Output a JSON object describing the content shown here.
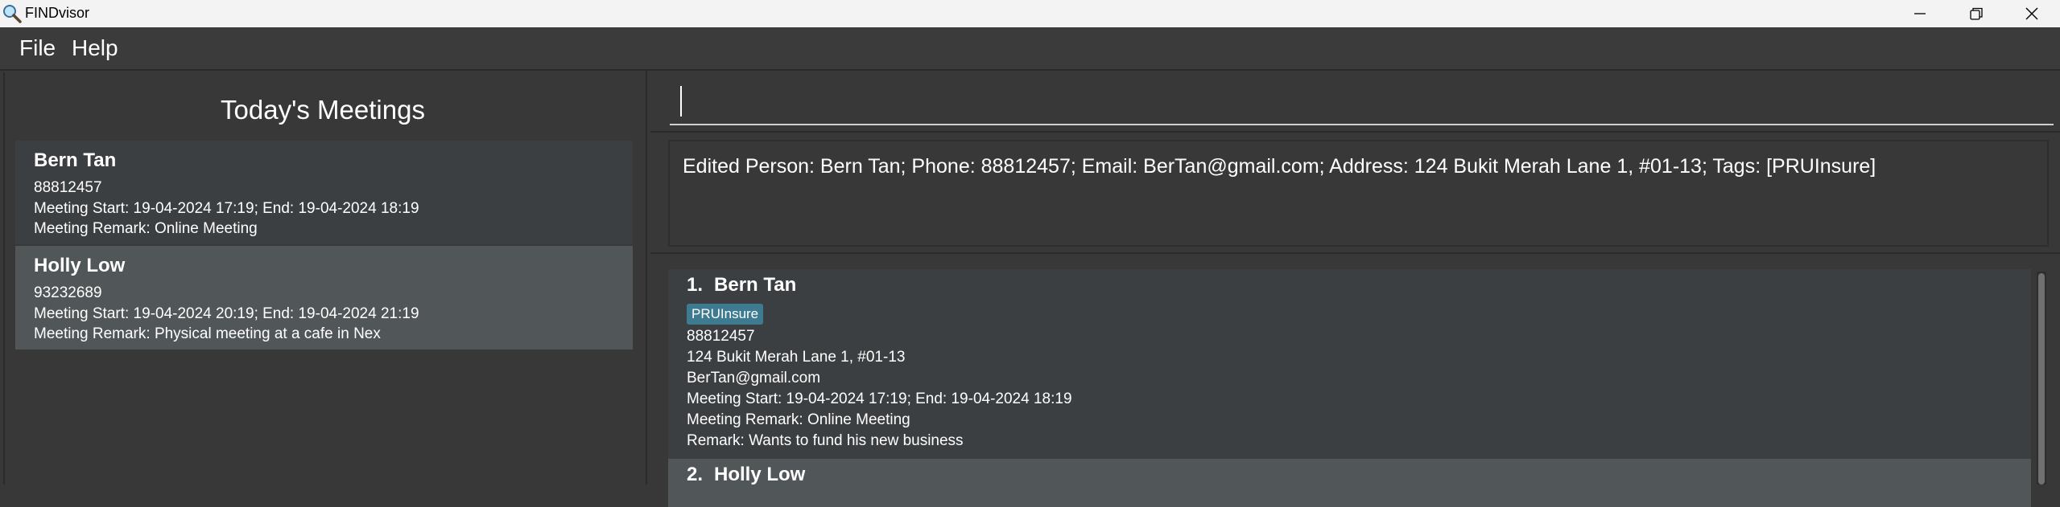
{
  "window": {
    "title": "FINDvisor",
    "icon": "magnifier-icon"
  },
  "menu": {
    "file": "File",
    "help": "Help"
  },
  "meetings": {
    "title": "Today's Meetings",
    "items": [
      {
        "name": "Bern Tan",
        "phone": "88812457",
        "time": "Meeting Start: 19-04-2024 17:19; End: 19-04-2024 18:19",
        "remark": "Meeting Remark: Online Meeting"
      },
      {
        "name": "Holly Low",
        "phone": "93232689",
        "time": "Meeting Start: 19-04-2024 20:19; End: 19-04-2024 21:19",
        "remark": "Meeting Remark: Physical meeting at a cafe in Nex"
      }
    ]
  },
  "command": {
    "value": ""
  },
  "result": {
    "text": "Edited Person: Bern Tan; Phone: 88812457; Email: BerTan@gmail.com; Address: 124 Bukit Merah Lane 1, #01-13; Tags: [PRUInsure]"
  },
  "persons": [
    {
      "index": "1.",
      "name": "Bern Tan",
      "tag": "PRUInsure",
      "phone": "88812457",
      "address": "124 Bukit Merah Lane 1, #01-13",
      "email": "BerTan@gmail.com",
      "meeting": "Meeting Start: 19-04-2024 17:19; End: 19-04-2024 18:19",
      "meeting_remark": "Meeting Remark: Online Meeting",
      "remark": "Remark: Wants to fund his new business"
    },
    {
      "index": "2.",
      "name": "Holly Low"
    }
  ],
  "colors": {
    "background": "#383838",
    "card": "#3c3f41",
    "card_selected": "#515658",
    "tag": "#3e7b91"
  }
}
